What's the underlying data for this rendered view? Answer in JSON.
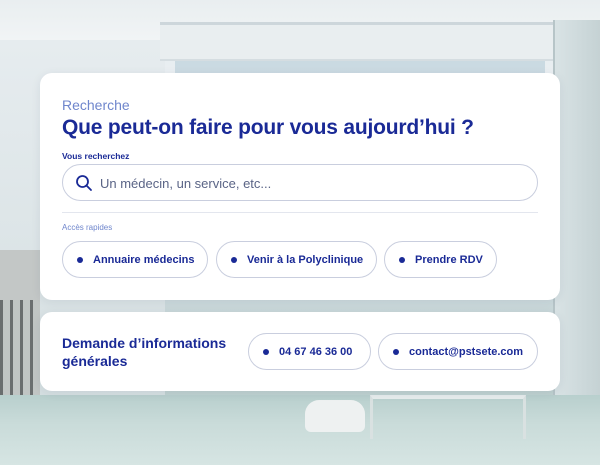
{
  "search_card": {
    "eyebrow": "Recherche",
    "headline": "Que peut-on faire pour vous aujourd’hui ?",
    "field_label": "Vous recherchez",
    "search_placeholder": "Un médecin, un service, etc...",
    "quick_label": "Accès rapides",
    "quick_links": [
      {
        "label": "Annuaire médecins"
      },
      {
        "label": "Venir à la Polyclinique"
      },
      {
        "label": "Prendre RDV"
      }
    ]
  },
  "info_card": {
    "title": "Demande d’informations générales",
    "phone": "04 67 46 36 00",
    "email": "contact@pstsete.com"
  },
  "colors": {
    "brand_blue": "#1a2a96",
    "accent_light": "#6f86cc",
    "border": "#c9cede"
  },
  "icons": {
    "search": "search-icon",
    "bullet": "dot-icon"
  }
}
